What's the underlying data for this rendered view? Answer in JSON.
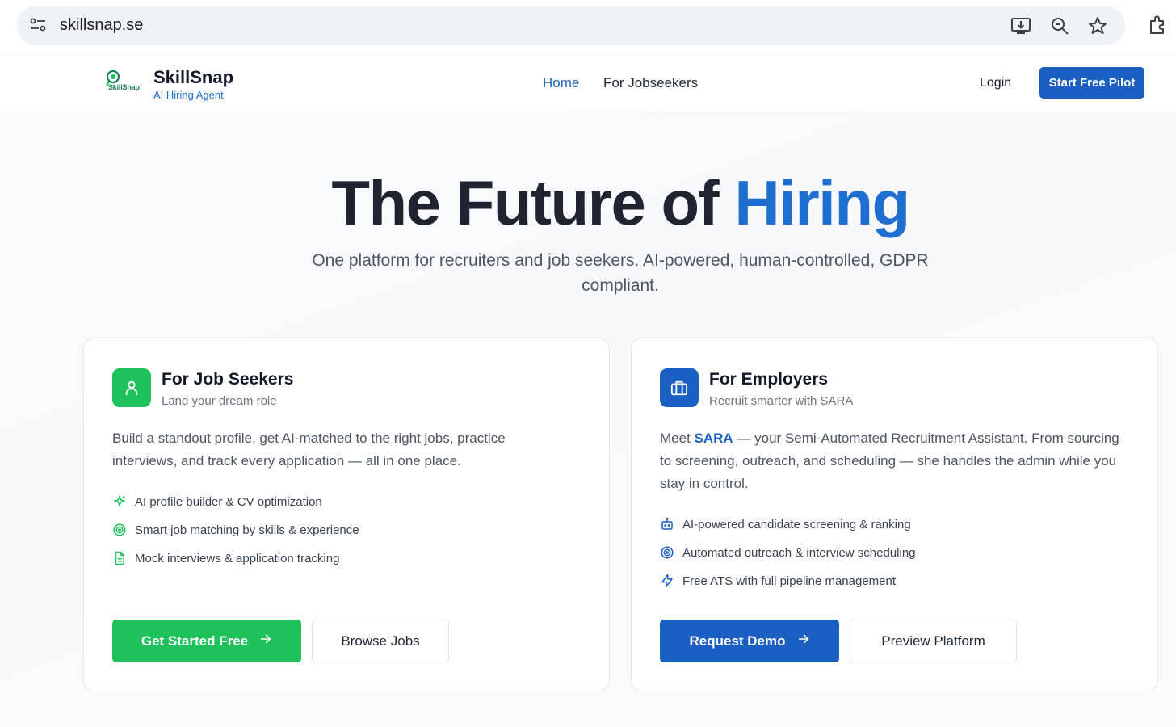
{
  "browser": {
    "url": "skillsnap.se",
    "icons": [
      "site-info-icon",
      "install-app-icon",
      "zoom-icon",
      "bookmark-star-icon",
      "extensions-icon"
    ]
  },
  "header": {
    "logo_text": "SkillSnap",
    "brand_name": "SkillSnap",
    "brand_tagline": "AI Hiring Agent",
    "nav": {
      "home": "Home",
      "jobseekers": "For Jobseekers"
    },
    "login": "Login",
    "cta": "Start Free Pilot"
  },
  "hero": {
    "title_main": "The Future of ",
    "title_accent": "Hiring",
    "subtitle": "One platform for recruiters and job seekers. AI-powered, human-controlled, GDPR compliant."
  },
  "seekers": {
    "title": "For Job Seekers",
    "subtitle": "Land your dream role",
    "description": "Build a standout profile, get AI-matched to the right jobs, practice interviews, and track every application — all in one place.",
    "features": [
      {
        "label": "AI profile builder & CV optimization",
        "icon": "sparkles-icon"
      },
      {
        "label": "Smart job matching by skills & experience",
        "icon": "target-icon"
      },
      {
        "label": "Mock interviews & application tracking",
        "icon": "document-icon"
      }
    ],
    "primary_button": "Get Started Free",
    "secondary_button": "Browse Jobs"
  },
  "employers": {
    "title": "For Employers",
    "subtitle": "Recruit smarter with SARA",
    "desc_prefix": "Meet ",
    "desc_highlight": "SARA",
    "desc_suffix": " — your Semi-Automated Recruitment Assistant. From sourcing to screening, outreach, and scheduling — she handles the admin while you stay in control.",
    "features": [
      {
        "label": "AI-powered candidate screening & ranking",
        "icon": "bot-icon"
      },
      {
        "label": "Automated outreach & interview scheduling",
        "icon": "target-icon"
      },
      {
        "label": "Free ATS with full pipeline management",
        "icon": "lightning-icon"
      }
    ],
    "primary_button": "Request Demo",
    "secondary_button": "Preview Platform"
  },
  "colors": {
    "accent_blue": "#1f6fd1",
    "button_blue": "#1a5fc1",
    "green": "#1fc25a"
  }
}
